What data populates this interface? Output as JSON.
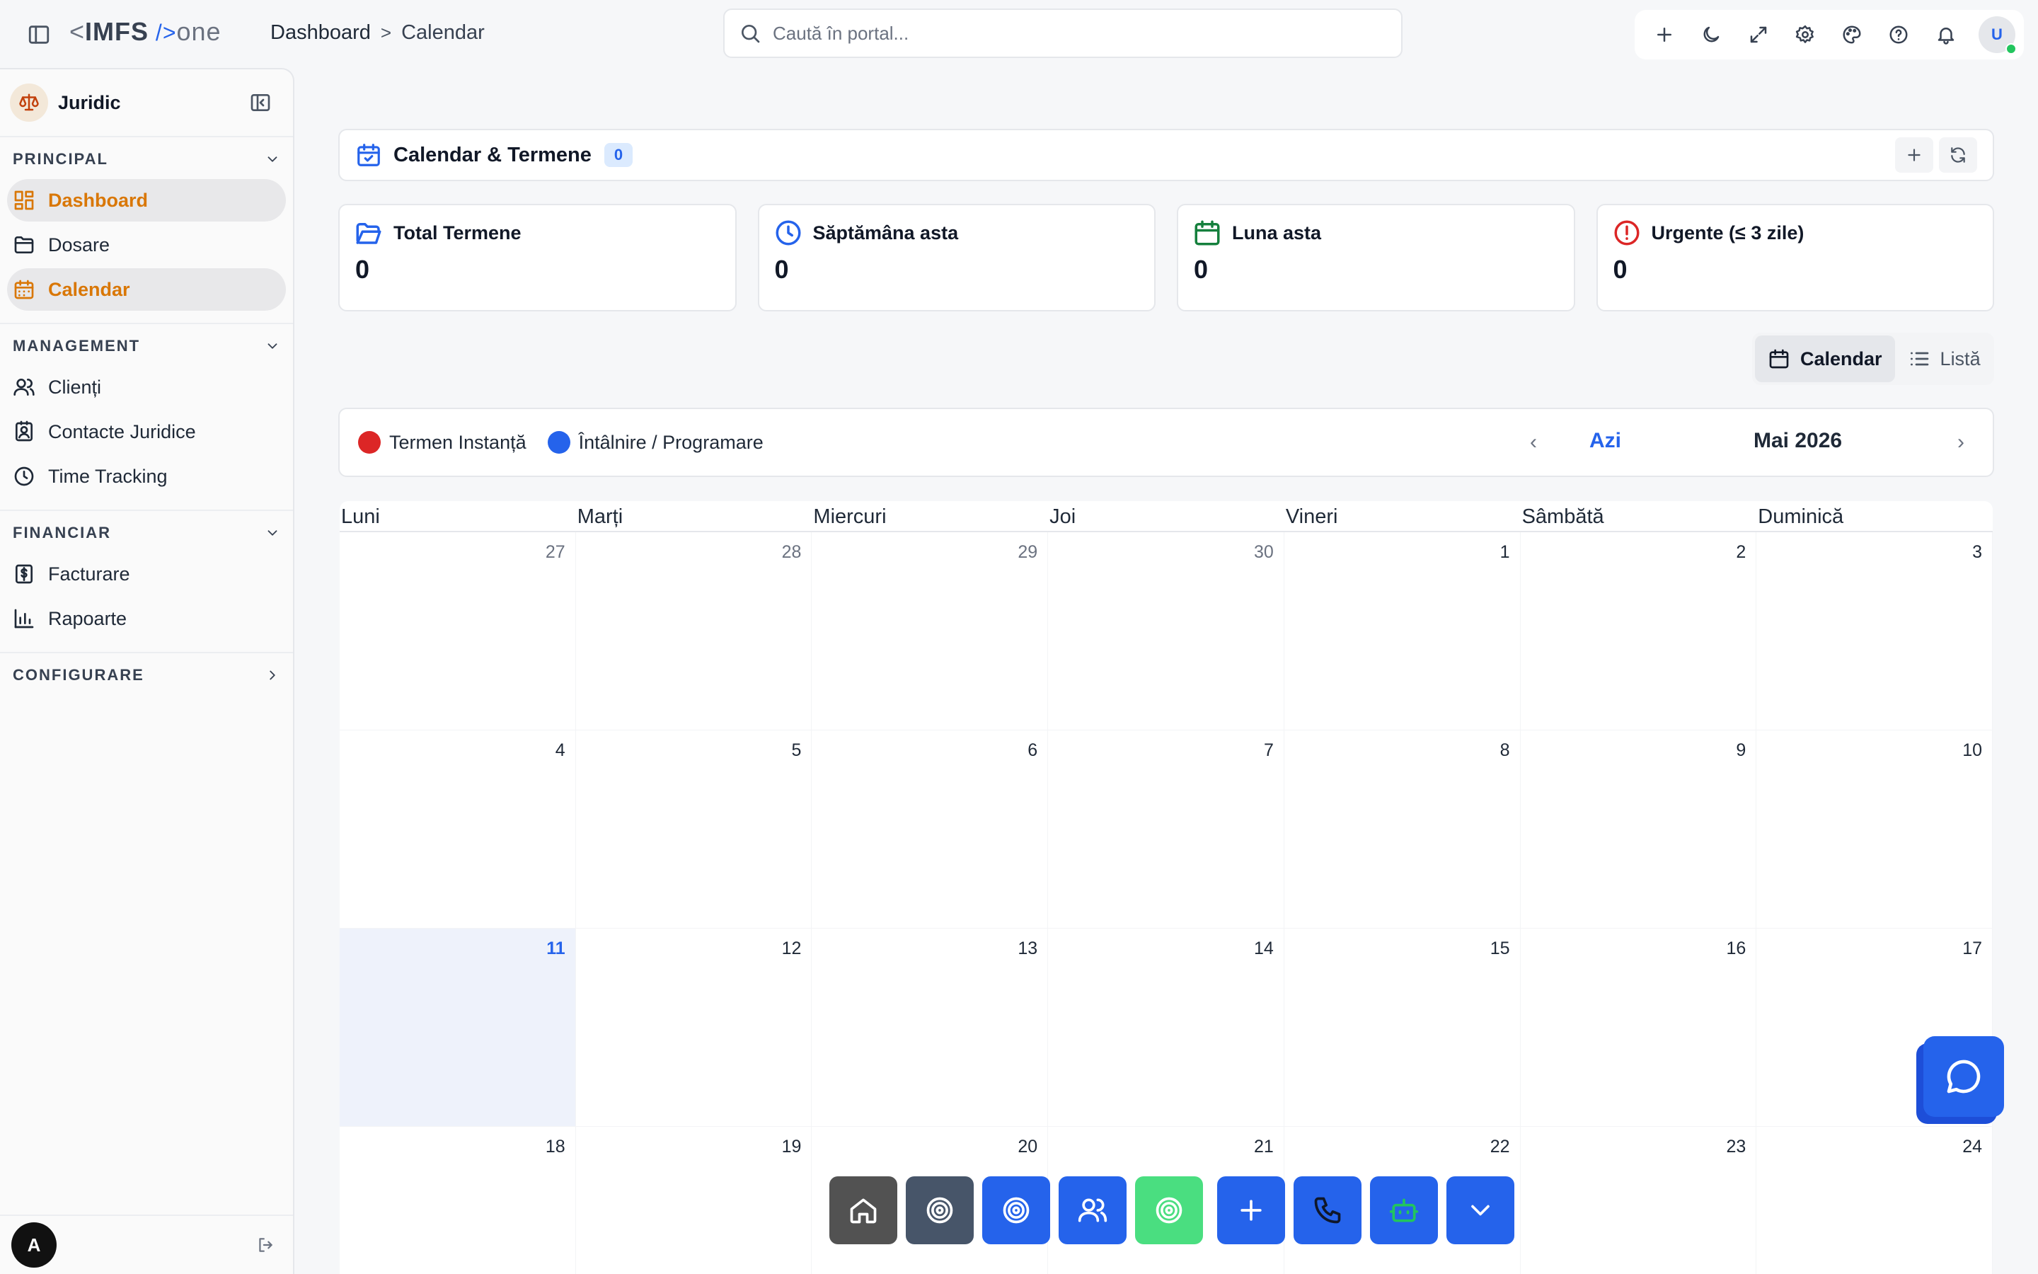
{
  "app": {
    "logo_lt": "<",
    "logo_name": "IMFS",
    "logo_slash": " />",
    "logo_suffix": "one"
  },
  "breadcrumb": {
    "root": "Dashboard",
    "separator": ">",
    "current": "Calendar"
  },
  "search": {
    "placeholder": "Caută în portal..."
  },
  "topbar": {
    "icons": [
      "plus-icon",
      "moon-icon",
      "expand-icon",
      "gear-icon",
      "palette-icon",
      "help-icon",
      "bell-icon"
    ],
    "user_initial": "U",
    "status_color": "#22c55e"
  },
  "sidebar": {
    "title": "Juridic",
    "sections": [
      {
        "title": "PRINCIPAL",
        "items": [
          {
            "label": "Dashboard",
            "icon": "dashboard-icon",
            "active": true
          },
          {
            "label": "Dosare",
            "icon": "folder-icon",
            "active": false
          },
          {
            "label": "Calendar",
            "icon": "calendar-icon",
            "active": true
          }
        ]
      },
      {
        "title": "MANAGEMENT",
        "items": [
          {
            "label": "Clienți",
            "icon": "users-icon"
          },
          {
            "label": "Contacte Juridice",
            "icon": "contact-icon"
          },
          {
            "label": "Time Tracking",
            "icon": "clock-icon"
          }
        ]
      },
      {
        "title": "FINANCIAR",
        "items": [
          {
            "label": "Facturare",
            "icon": "invoice-icon"
          },
          {
            "label": "Rapoarte",
            "icon": "chart-icon"
          }
        ]
      },
      {
        "title": "CONFIGURARE",
        "items": []
      }
    ],
    "user_initial": "A",
    "accent_color": "#d97706"
  },
  "page": {
    "title": "Calendar & Termene",
    "count_badge": "0"
  },
  "stats": [
    {
      "label": "Total Termene",
      "value": "0",
      "icon": "folder-open-icon",
      "color": "#2563eb"
    },
    {
      "label": "Săptămâna asta",
      "value": "0",
      "icon": "clock-icon",
      "color": "#2563eb"
    },
    {
      "label": "Luna asta",
      "value": "0",
      "icon": "calendar-icon",
      "color": "#15803d"
    },
    {
      "label": "Urgente (≤ 3 zile)",
      "value": "0",
      "icon": "alert-circle-icon",
      "color": "#dc2626"
    }
  ],
  "view_toggle": {
    "calendar": "Calendar",
    "list": "Listă",
    "active": "calendar"
  },
  "legend": [
    {
      "label": "Termen Instanță",
      "color": "#dc2626"
    },
    {
      "label": "Întâlnire / Programare",
      "color": "#2563eb"
    }
  ],
  "nav": {
    "prev": "‹",
    "today": "Azi",
    "month": "Mai 2026",
    "next": "›"
  },
  "calendar": {
    "weekdays": [
      "Luni",
      "Marți",
      "Miercuri",
      "Joi",
      "Vineri",
      "Sâmbătă",
      "Duminică"
    ],
    "today": "11",
    "days": [
      {
        "n": "27",
        "other": true
      },
      {
        "n": "28",
        "other": true
      },
      {
        "n": "29",
        "other": true
      },
      {
        "n": "30",
        "other": true
      },
      {
        "n": "1"
      },
      {
        "n": "2"
      },
      {
        "n": "3"
      },
      {
        "n": "4"
      },
      {
        "n": "5"
      },
      {
        "n": "6"
      },
      {
        "n": "7"
      },
      {
        "n": "8"
      },
      {
        "n": "9"
      },
      {
        "n": "10"
      },
      {
        "n": "11",
        "today": true
      },
      {
        "n": "12"
      },
      {
        "n": "13"
      },
      {
        "n": "14"
      },
      {
        "n": "15"
      },
      {
        "n": "16"
      },
      {
        "n": "17"
      },
      {
        "n": "18"
      },
      {
        "n": "19"
      },
      {
        "n": "20"
      },
      {
        "n": "21"
      },
      {
        "n": "22"
      },
      {
        "n": "23"
      },
      {
        "n": "24"
      }
    ]
  },
  "dock": [
    {
      "name": "home-icon",
      "color": "#525252"
    },
    {
      "name": "target-icon",
      "color": "#475569"
    },
    {
      "name": "target-icon",
      "color": "#2563eb"
    },
    {
      "name": "users-icon",
      "color": "#2563eb"
    },
    {
      "name": "target-icon",
      "color": "#4ade80"
    },
    {
      "name": "plus-icon",
      "color": "#2563eb"
    },
    {
      "name": "phone-icon",
      "color": "#2563eb"
    },
    {
      "name": "bot-icon",
      "color": "#2563eb"
    },
    {
      "name": "chevron-down-icon",
      "color": "#2563eb"
    }
  ],
  "chat": {
    "icon": "chat-icon",
    "color": "#2563eb"
  }
}
